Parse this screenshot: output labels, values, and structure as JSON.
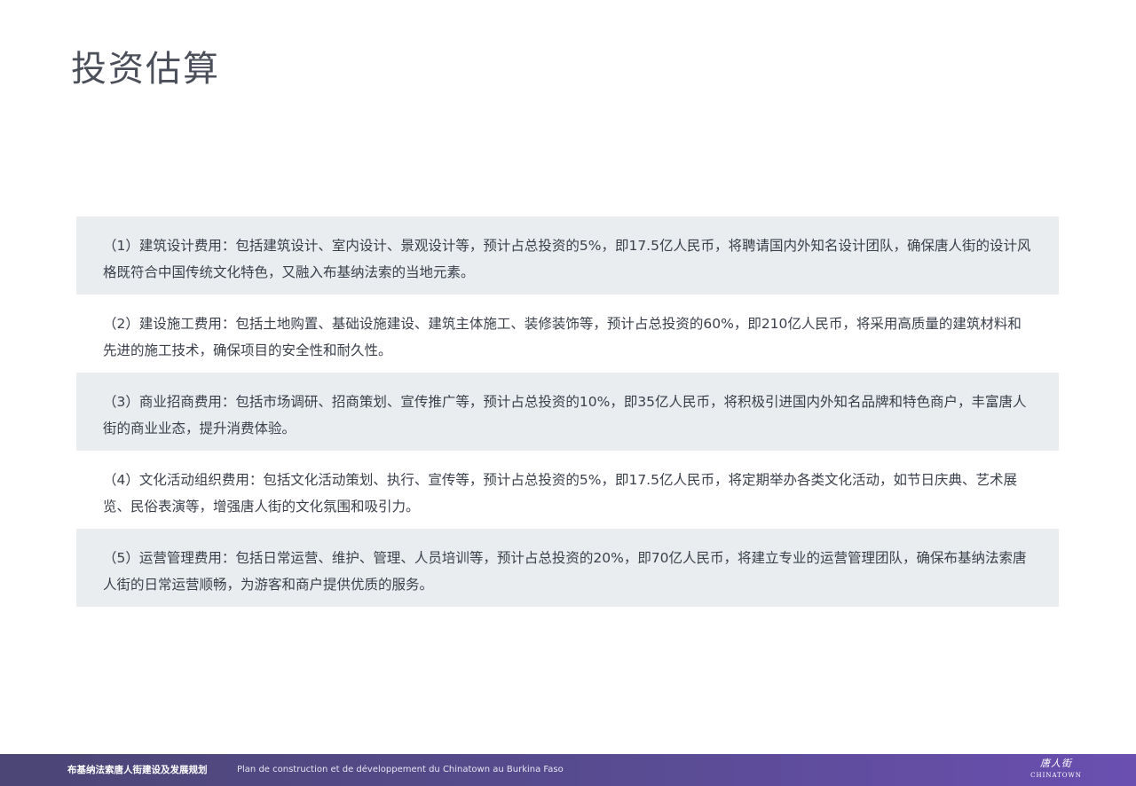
{
  "page": {
    "title": "投资估算"
  },
  "items": [
    "（1）建筑设计费用：包括建筑设计、室内设计、景观设计等，预计占总投资的5%，即17.5亿人民币，将聘请国内外知名设计团队，确保唐人街的设计风格既符合中国传统文化特色，又融入布基纳法索的当地元素。",
    "（2）建设施工费用：包括土地购置、基础设施建设、建筑主体施工、装修装饰等，预计占总投资的60%，即210亿人民币，将采用高质量的建筑材料和先进的施工技术，确保项目的安全性和耐久性。",
    "（3）商业招商费用：包括市场调研、招商策划、宣传推广等，预计占总投资的10%，即35亿人民币，将积极引进国内外知名品牌和特色商户，丰富唐人街的商业业态，提升消费体验。",
    "（4）文化活动组织费用：包括文化活动策划、执行、宣传等，预计占总投资的5%，即17.5亿人民币，将定期举办各类文化活动，如节日庆典、艺术展览、民俗表演等，增强唐人街的文化氛围和吸引力。",
    "（5）运营管理费用：包括日常运营、维护、管理、人员培训等，预计占总投资的20%，即70亿人民币，将建立专业的运营管理团队，确保布基纳法索唐人街的日常运营顺畅，为游客和商户提供优质的服务。"
  ],
  "footer": {
    "title_cn": "布基纳法索唐人街建设及发展规划",
    "title_fr": "Plan de construction et de développement du Chinatown au Burkina Faso",
    "logo_mark": "唐人街",
    "logo_text": "CHINATOWN"
  },
  "colors": {
    "title_text": "#4a4f5a",
    "body_text": "#3a3f4a",
    "shaded_row": "#e9edf0",
    "footer_start": "#4b4675",
    "footer_end": "#6a4fb0"
  }
}
